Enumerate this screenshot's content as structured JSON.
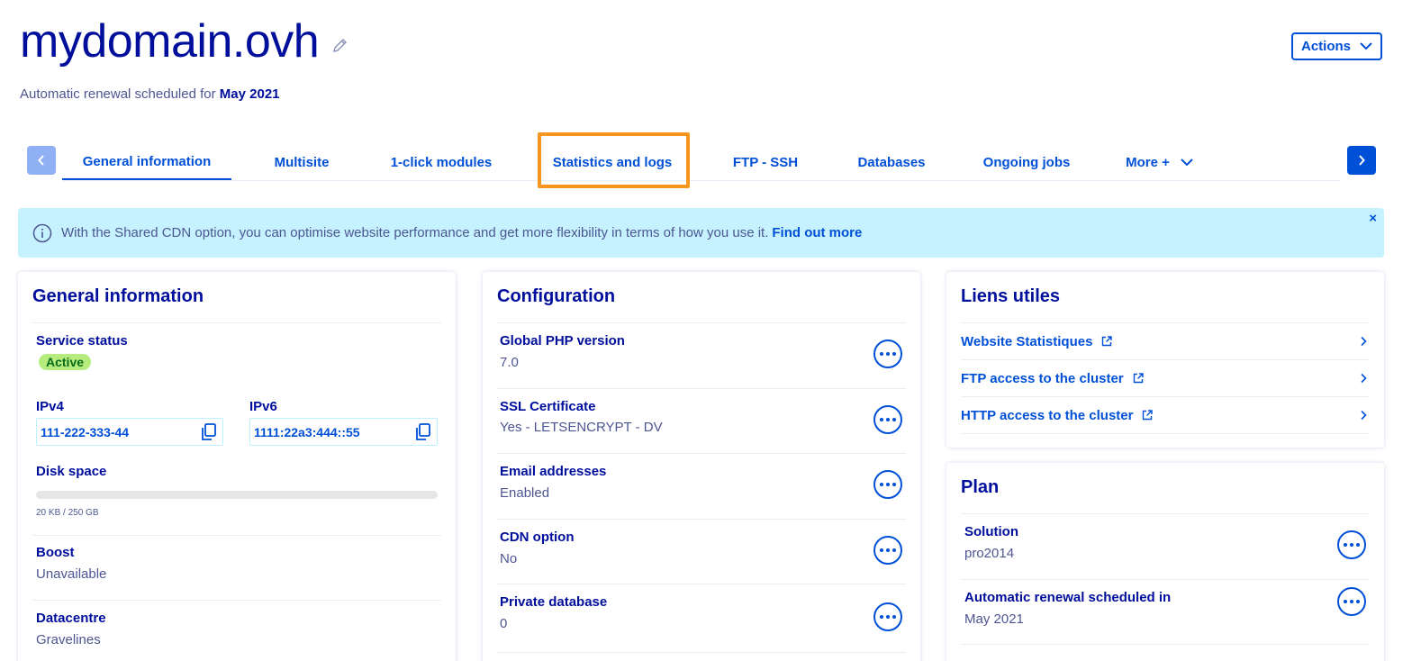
{
  "header": {
    "domain": "mydomain.ovh",
    "renewal_prefix": "Automatic renewal scheduled for ",
    "renewal_date": "May 2021",
    "actions_label": "Actions"
  },
  "tabs": [
    {
      "label": "General information",
      "active": true
    },
    {
      "label": "Multisite"
    },
    {
      "label": "1-click modules"
    },
    {
      "label": "Statistics and logs",
      "highlighted": true
    },
    {
      "label": "FTP - SSH"
    },
    {
      "label": "Databases"
    },
    {
      "label": "Ongoing jobs"
    },
    {
      "label": "More +"
    }
  ],
  "banner": {
    "text": "With the Shared CDN option, you can optimise website performance and get more flexibility in terms of how you use it.",
    "link": "Find out more",
    "close": "×"
  },
  "general": {
    "title": "General information",
    "service_status_label": "Service status",
    "service_status_value": "Active",
    "ipv4_label": "IPv4",
    "ipv4_value": "111-222-333-44",
    "ipv6_label": "IPv6",
    "ipv6_value": "1111:22a3:444::55",
    "disk_label": "Disk space",
    "disk_text": "20 KB / 250 GB",
    "disk_used_fraction": 0.0,
    "boost_label": "Boost",
    "boost_value": "Unavailable",
    "datacentre_label": "Datacentre",
    "datacentre_value": "Gravelines"
  },
  "configuration": {
    "title": "Configuration",
    "items": [
      {
        "label": "Global PHP version",
        "value": "7.0"
      },
      {
        "label": "SSL Certificate",
        "value": "Yes - LETSENCRYPT - DV"
      },
      {
        "label": "Email addresses",
        "value": "Enabled"
      },
      {
        "label": "CDN option",
        "value": "No"
      },
      {
        "label": "Private database",
        "value": "0"
      }
    ]
  },
  "links": {
    "title": "Liens utiles",
    "items": [
      {
        "label": "Website Statistiques"
      },
      {
        "label": "FTP access to the cluster"
      },
      {
        "label": "HTTP access to the cluster"
      }
    ]
  },
  "plan": {
    "title": "Plan",
    "solution_label": "Solution",
    "solution_value": "pro2014",
    "renewal_label": "Automatic renewal scheduled in",
    "renewal_value": "May 2021"
  },
  "colors": {
    "primary": "#0050d7",
    "title": "#000e9c",
    "highlight": "#f6961f",
    "banner_bg": "#c5f2fe",
    "badge_bg": "#b5ec7d"
  }
}
